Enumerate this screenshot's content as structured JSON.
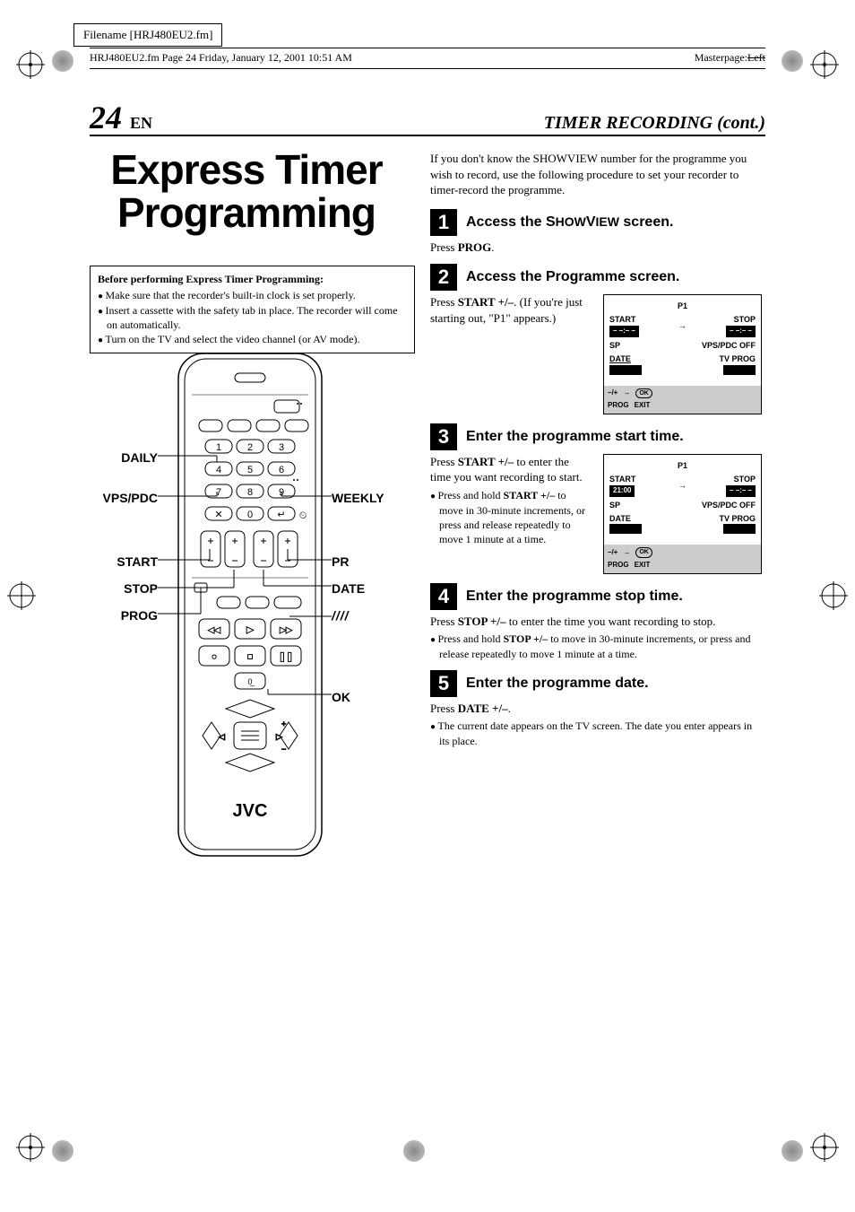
{
  "filename": "Filename [HRJ480EU2.fm]",
  "headerLine": "HRJ480EU2.fm  Page 24  Friday, January 12, 2001  10:51 AM",
  "masterpageLabel": "Masterpage:",
  "masterpageVal": "Left",
  "pageNumber": "24",
  "pageLang": "EN",
  "sectionTitle": "TIMER RECORDING (cont.)",
  "docTitle": "Express Timer Programming",
  "prereq": {
    "heading": "Before performing Express Timer Programming:",
    "items": [
      "Make sure that the recorder's built-in clock is set properly.",
      "Insert a cassette with the safety tab in place. The recorder will come on automatically.",
      "Turn on the TV and select the video channel (or AV mode)."
    ]
  },
  "remoteLabels": {
    "daily": "DAILY",
    "vpspdc": "VPS/PDC",
    "start": "START",
    "stop": "STOP",
    "prog": "PROG",
    "weekly": "WEEKLY",
    "pr": "PR",
    "date": "DATE",
    "ok": "OK",
    "brand": "JVC",
    "menu": "////"
  },
  "intro": "If you don't know the SHOWVIEW number for the programme you wish to record, use the following procedure to set your recorder to timer-record the programme.",
  "steps": [
    {
      "num": "1",
      "title": "Access the SHOWVIEW screen.",
      "body": "Press PROG.",
      "bold": "PROG"
    },
    {
      "num": "2",
      "title": "Access the Programme screen.",
      "body": "Press START +/–. (If you're just starting out, \"P1\" appears.)",
      "bold": "START +/–",
      "screen": {
        "title": "P1",
        "startLabel": "START",
        "startVal": "– –:– –",
        "stopLabel": "STOP",
        "stopVal": "– –:– –",
        "mode": "SP",
        "vps": "VPS/PDC OFF",
        "dateLabel": "DATE",
        "dateVal": "",
        "progLabel": "TV PROG",
        "progVal": "",
        "foot1": "–/+",
        "foot2": "PROG",
        "foot3": "EXIT"
      }
    },
    {
      "num": "3",
      "title": "Enter the programme start time.",
      "body": "Press START +/– to enter the time you want recording to start.",
      "bold": "START +/–",
      "bullets": [
        "Press and hold START +/– to move in 30-minute increments, or press and release repeatedly to move 1 minute at a time."
      ],
      "screen": {
        "title": "P1",
        "startLabel": "START",
        "startVal": "21:00",
        "stopLabel": "STOP",
        "stopVal": "– –:– –",
        "mode": "SP",
        "vps": "VPS/PDC OFF",
        "dateLabel": "DATE",
        "dateVal": "",
        "progLabel": "TV PROG",
        "progVal": "",
        "foot1": "–/+",
        "foot2": "PROG",
        "foot3": "EXIT"
      }
    },
    {
      "num": "4",
      "title": "Enter the programme stop time.",
      "body": "Press STOP +/– to enter the time you want recording to stop.",
      "bold": "STOP +/–",
      "bullets": [
        "Press and hold STOP +/– to move in 30-minute increments, or press and release repeatedly to move 1 minute at a time."
      ]
    },
    {
      "num": "5",
      "title": "Enter the programme date.",
      "body": "Press DATE +/–.",
      "bold": "DATE +/–",
      "bullets": [
        "The current date appears on the TV screen. The date you enter appears in its place."
      ]
    }
  ]
}
